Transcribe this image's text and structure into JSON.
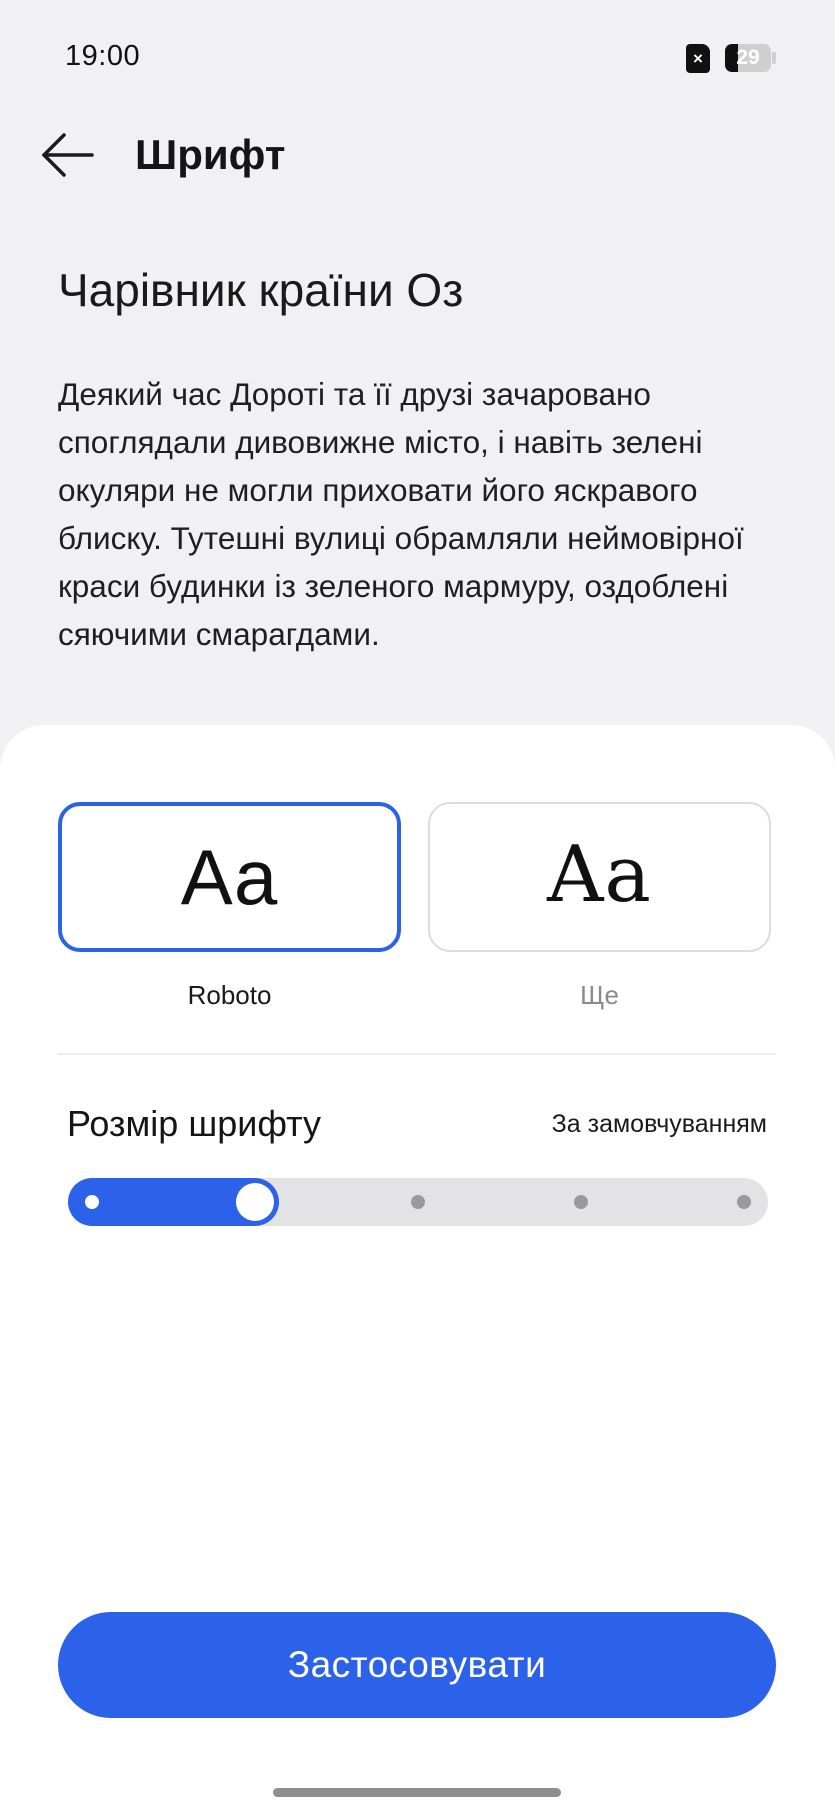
{
  "status_bar": {
    "time": "19:00",
    "battery_level": "29",
    "battery_fraction": 0.29,
    "sim_icon": "sim-no-card-icon",
    "battery_icon": "battery-icon"
  },
  "header": {
    "back_icon": "arrow-left-icon",
    "title": "Шрифт"
  },
  "preview": {
    "title": "Чарівник країни Оз",
    "text": "Деякий час Дороті та її друзі зачаровано споглядали дивовижне місто, і навіть зелені окуляри не могли приховати його яскравого блиску. Тутешні вулиці обрамляли неймовірної краси будинки із зеленого мармуру, оздоблені сяючими смарагдами."
  },
  "fonts": [
    {
      "sample": "Aa",
      "label": "Roboto",
      "selected": true
    },
    {
      "sample": "Aa",
      "label": "Ще",
      "selected": false
    }
  ],
  "font_size": {
    "label": "Розмір шрифту",
    "value": "За замовчуванням",
    "steps": 5,
    "selected_step": 2
  },
  "apply_button": {
    "label": "Застосовувати"
  },
  "colors": {
    "accent": "#2c62ea",
    "background": "#f1f1f3",
    "sheet": "#ffffff",
    "label_selected": "#1a1a1a",
    "label_unselected": "#8a8a8a"
  }
}
